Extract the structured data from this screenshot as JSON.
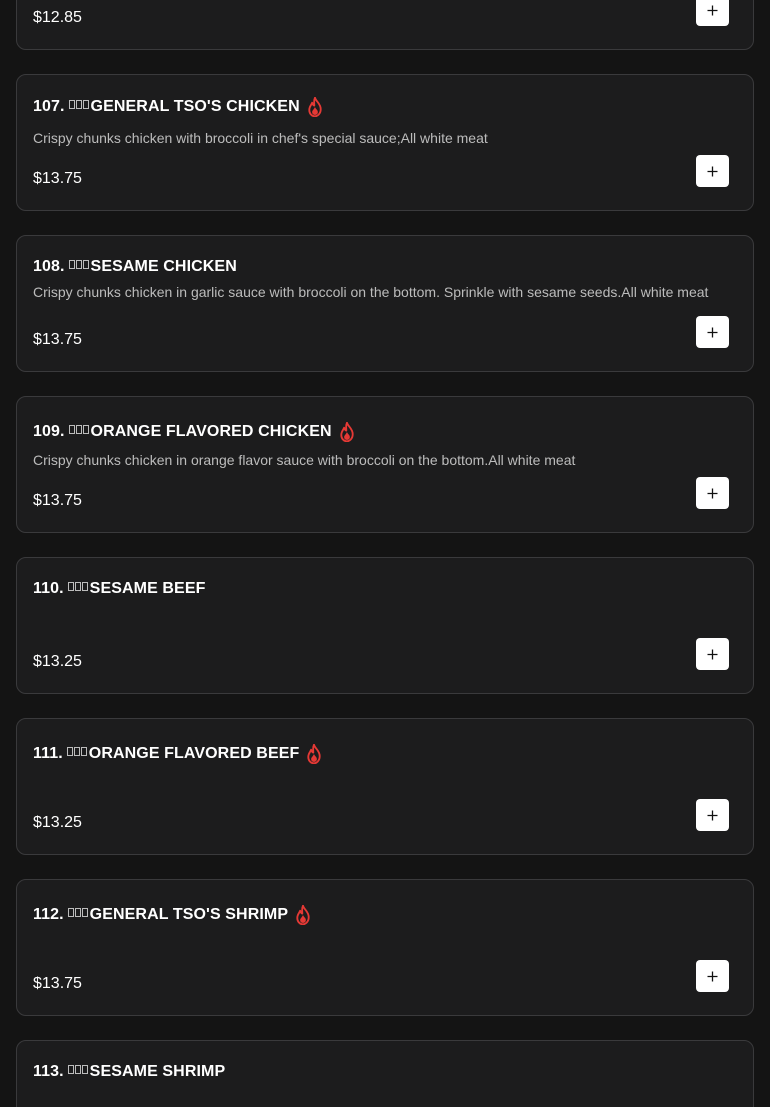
{
  "menu": {
    "items": [
      {
        "number": "",
        "name": "",
        "description": "",
        "price": "$12.85",
        "spicy": false
      },
      {
        "number": "107.",
        "name": "GENERAL TSO'S CHICKEN",
        "description": "Crispy chunks chicken with broccoli in chef's special sauce;All white meat",
        "price": "$13.75",
        "spicy": true
      },
      {
        "number": "108.",
        "name": "SESAME CHICKEN",
        "description": "Crispy chunks chicken in garlic sauce with broccoli on the bottom. Sprinkle with sesame seeds.All white meat",
        "price": "$13.75",
        "spicy": false
      },
      {
        "number": "109.",
        "name": "ORANGE FLAVORED CHICKEN",
        "description": "Crispy chunks chicken in orange flavor sauce with broccoli on the bottom.All white meat",
        "price": "$13.75",
        "spicy": true
      },
      {
        "number": "110.",
        "name": "SESAME BEEF",
        "description": "",
        "price": "$13.25",
        "spicy": false
      },
      {
        "number": "111.",
        "name": "ORANGE FLAVORED BEEF",
        "description": "",
        "price": "$13.25",
        "spicy": true
      },
      {
        "number": "112.",
        "name": "GENERAL TSO'S SHRIMP",
        "description": "",
        "price": "$13.75",
        "spicy": true
      },
      {
        "number": "113.",
        "name": "SESAME SHRIMP",
        "description": "",
        "price": "",
        "spicy": false
      }
    ]
  },
  "icons": {
    "spicy": "fire-icon",
    "add": "plus-icon"
  },
  "colors": {
    "background": "#141414",
    "card": "#1c1c1d",
    "border": "#3a3a3c",
    "spicy": "#e53935",
    "text": "#ffffff",
    "muted": "#bcbcbc"
  }
}
